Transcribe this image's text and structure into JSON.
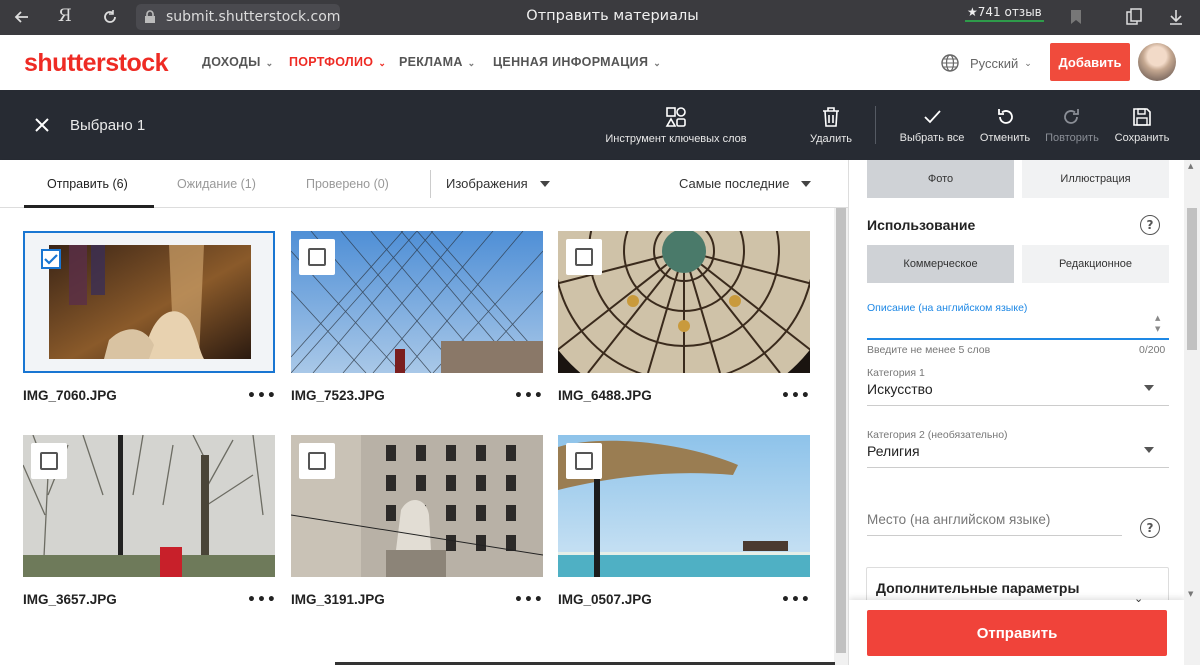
{
  "browser": {
    "url": "submit.shutterstock.com",
    "page_title": "Отправить материалы",
    "rating": "★741 отзыв"
  },
  "site": {
    "logo": "shutterstock",
    "nav": [
      "ДОХОДЫ",
      "ПОРТФОЛИО",
      "РЕКЛАМА",
      "ЦЕННАЯ ИНФОРМАЦИЯ"
    ],
    "language": "Русский",
    "add_button": "Добавить",
    "accent": "#f04b3c"
  },
  "toolbar": {
    "selected": "Выбрано 1",
    "keyword_tool": "Инструмент ключевых слов",
    "delete": "Удалить",
    "select_all": "Выбрать все",
    "undo": "Отменить",
    "redo": "Повторить",
    "save": "Сохранить"
  },
  "tabs": {
    "submit": "Отправить (6)",
    "pending": "Ожидание (1)",
    "reviewed": "Проверено (0)",
    "type_filter": "Изображения",
    "sort": "Самые последние"
  },
  "files": [
    {
      "name": "IMG_7060.JPG",
      "selected": true
    },
    {
      "name": "IMG_7523.JPG",
      "selected": false
    },
    {
      "name": "IMG_6488.JPG",
      "selected": false
    },
    {
      "name": "IMG_3657.JPG",
      "selected": false
    },
    {
      "name": "IMG_3191.JPG",
      "selected": false
    },
    {
      "name": "IMG_0507.JPG",
      "selected": false
    }
  ],
  "more": "•••",
  "panel": {
    "type_photo": "Фото",
    "type_illustration": "Иллюстрация",
    "usage_title": "Использование",
    "usage_commercial": "Коммерческое",
    "usage_editorial": "Редакционное",
    "description_label": "Описание (на английском языке)",
    "description_hint": "Введите не менее 5 слов",
    "description_count": "0/200",
    "category1_label": "Категория 1",
    "category1_value": "Искусство",
    "category2_label": "Категория 2 (необязательно)",
    "category2_value": "Религия",
    "location_placeholder": "Место (на английском языке)",
    "advanced": "Дополнительные параметры",
    "submit": "Отправить",
    "help": "?"
  }
}
